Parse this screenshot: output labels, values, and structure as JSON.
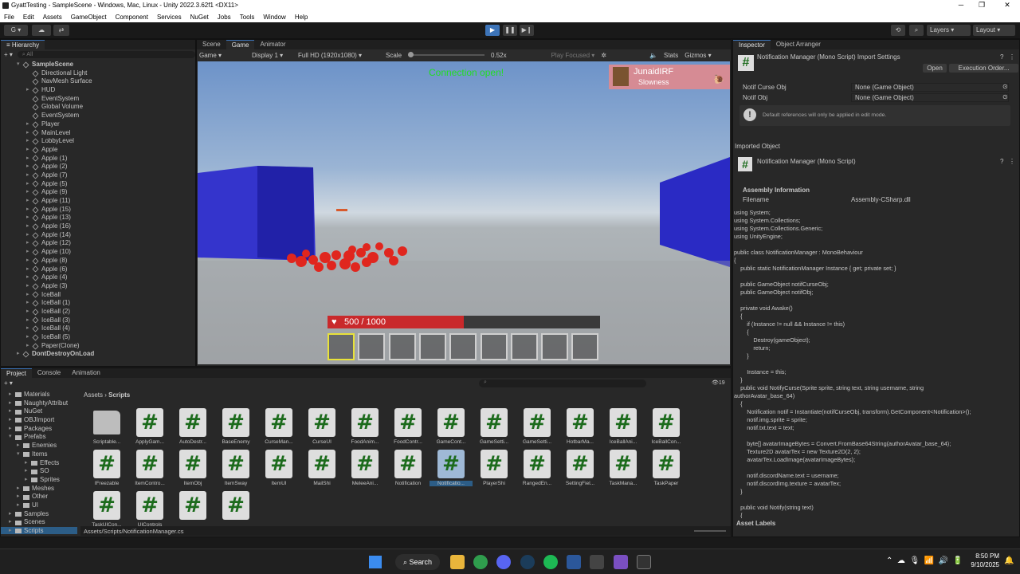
{
  "window": {
    "title": "GyattTesting - SampleScene - Windows, Mac, Linux - Unity 2022.3.62f1 <DX11>",
    "min": "─",
    "max": "❐",
    "close": "✕"
  },
  "menu": [
    "File",
    "Edit",
    "Assets",
    "GameObject",
    "Component",
    "Services",
    "NuGet",
    "Jobs",
    "Tools",
    "Window",
    "Help"
  ],
  "toolbar": {
    "account": "G",
    "layers": "Layers",
    "layout": "Layout"
  },
  "hierarchy": {
    "title": "Hierarchy",
    "search": "All",
    "items": [
      {
        "label": "SampleScene",
        "depth": 0,
        "arrow": "▾",
        "scene": true
      },
      {
        "label": "Directional Light",
        "depth": 1
      },
      {
        "label": "NavMesh Surface",
        "depth": 1
      },
      {
        "label": "HUD",
        "depth": 1,
        "arrow": "▸"
      },
      {
        "label": "EventSystem",
        "depth": 1
      },
      {
        "label": "Global Volume",
        "depth": 1
      },
      {
        "label": "EventSystem",
        "depth": 1
      },
      {
        "label": "Player",
        "depth": 1,
        "arrow": "▸"
      },
      {
        "label": "MainLevel",
        "depth": 1,
        "arrow": "▸"
      },
      {
        "label": "LobbyLevel",
        "depth": 1,
        "arrow": "▸"
      },
      {
        "label": "Apple",
        "depth": 1,
        "arrow": "▸"
      },
      {
        "label": "Apple (1)",
        "depth": 1,
        "arrow": "▸"
      },
      {
        "label": "Apple (2)",
        "depth": 1,
        "arrow": "▸"
      },
      {
        "label": "Apple (7)",
        "depth": 1,
        "arrow": "▸"
      },
      {
        "label": "Apple (5)",
        "depth": 1,
        "arrow": "▸"
      },
      {
        "label": "Apple (9)",
        "depth": 1,
        "arrow": "▸"
      },
      {
        "label": "Apple (11)",
        "depth": 1,
        "arrow": "▸"
      },
      {
        "label": "Apple (15)",
        "depth": 1,
        "arrow": "▸"
      },
      {
        "label": "Apple (13)",
        "depth": 1,
        "arrow": "▸"
      },
      {
        "label": "Apple (16)",
        "depth": 1,
        "arrow": "▸"
      },
      {
        "label": "Apple (14)",
        "depth": 1,
        "arrow": "▸"
      },
      {
        "label": "Apple (12)",
        "depth": 1,
        "arrow": "▸"
      },
      {
        "label": "Apple (10)",
        "depth": 1,
        "arrow": "▸"
      },
      {
        "label": "Apple (8)",
        "depth": 1,
        "arrow": "▸"
      },
      {
        "label": "Apple (6)",
        "depth": 1,
        "arrow": "▸"
      },
      {
        "label": "Apple (4)",
        "depth": 1,
        "arrow": "▸"
      },
      {
        "label": "Apple (3)",
        "depth": 1,
        "arrow": "▸"
      },
      {
        "label": "IceBall",
        "depth": 1,
        "arrow": "▸"
      },
      {
        "label": "IceBall (1)",
        "depth": 1,
        "arrow": "▸"
      },
      {
        "label": "IceBall (2)",
        "depth": 1,
        "arrow": "▸"
      },
      {
        "label": "IceBall (3)",
        "depth": 1,
        "arrow": "▸"
      },
      {
        "label": "IceBall (4)",
        "depth": 1,
        "arrow": "▸"
      },
      {
        "label": "IceBall (5)",
        "depth": 1,
        "arrow": "▸"
      },
      {
        "label": "Paper(Clone)",
        "depth": 1,
        "arrow": "▸"
      },
      {
        "label": "DontDestroyOnLoad",
        "depth": 0,
        "arrow": "▸",
        "scene": true
      }
    ]
  },
  "scene_tabs": [
    "Scene",
    "Game",
    "Animator"
  ],
  "game_bar": {
    "display_mode": "Game",
    "display": "Display 1",
    "resolution": "Full HD (1920x1080)",
    "scale_label": "Scale",
    "scale_value": "0.52x",
    "play_focused": "Play Focused",
    "stats": "Stats",
    "gizmos": "Gizmos"
  },
  "game": {
    "connection": "Connection open!",
    "notif_user": "JunaidIRF",
    "notif_text": "Slowness",
    "hp": "500 / 1000",
    "hp_fraction": 0.5,
    "slot_count": 9,
    "selected_slot": 0
  },
  "inspector": {
    "tabs": [
      "Inspector",
      "Object Arranger"
    ],
    "header": "Notification Manager (Mono Script) Import Settings",
    "open_btn": "Open",
    "exec_btn": "Execution Order...",
    "fields": [
      {
        "label": "Notif Curse Obj",
        "value": "None (Game Object)"
      },
      {
        "label": "Notif Obj",
        "value": "None (Game Object)"
      }
    ],
    "info": "Default references will only be applied in edit mode.",
    "imported_label": "Imported Object",
    "script_name": "Notification Manager (Mono Script)",
    "assembly_title": "Assembly Information",
    "filename_label": "Filename",
    "filename_value": "Assembly-CSharp.dll",
    "code": "using System;\nusing System.Collections;\nusing System.Collections.Generic;\nusing UnityEngine;\n\npublic class NotificationManager : MonoBehaviour\n{\n    public static NotificationManager Instance { get; private set; }\n\n    public GameObject notifCurseObj;\n    public GameObject notifObj;\n\n    private void Awake()\n    {\n        if (Instance != null && Instance != this)\n        {\n            Destroy(gameObject);\n            return;\n        }\n\n        Instance = this;\n    }\n    public void NotifyCurse(Sprite sprite, string text, string username, string\nauthorAvatar_base_64)\n    {\n        Notification notif = Instantiate(notifCurseObj, transform).GetComponent<Notification>();\n        notif.img.sprite = sprite;\n        notif.txt.text = text;\n\n        byte[] avatarImageBytes = Convert.FromBase64String(authorAvatar_base_64);\n        Texture2D avatarTex = new Texture2D(2, 2);\n        avatarTex.LoadImage(avatarImageBytes);\n\n        notif.discordName.text = username;\n        notif.discordImg.texture = avatarTex;\n    }\n\n    public void Notify(string text)\n    {\n        Notification notif = Instantiate(notifObj, transform).GetComponent<Notification>();",
    "asset_labels": "Asset Labels"
  },
  "project": {
    "tabs": [
      "Project",
      "Console",
      "Animation"
    ],
    "breadcrumb_root": "Assets",
    "breadcrumb_current": "Scripts",
    "badge": "19",
    "path": "Assets/Scripts/NotificationManager.cs",
    "tree": [
      {
        "label": "Materials",
        "depth": 1
      },
      {
        "label": "NaughtyAttribut",
        "depth": 1
      },
      {
        "label": "NuGet",
        "depth": 1
      },
      {
        "label": "OBJImport",
        "depth": 1
      },
      {
        "label": "Packages",
        "depth": 1
      },
      {
        "label": "Prefabs",
        "depth": 1,
        "open": true
      },
      {
        "label": "Enemies",
        "depth": 2
      },
      {
        "label": "Items",
        "depth": 2,
        "open": true
      },
      {
        "label": "Effects",
        "depth": 3
      },
      {
        "label": "SO",
        "depth": 3
      },
      {
        "label": "Sprites",
        "depth": 3
      },
      {
        "label": "Meshes",
        "depth": 2
      },
      {
        "label": "Other",
        "depth": 2
      },
      {
        "label": "UI",
        "depth": 2
      },
      {
        "label": "Samples",
        "depth": 1
      },
      {
        "label": "Scenes",
        "depth": 1
      },
      {
        "label": "Scripts",
        "depth": 1,
        "selected": true
      }
    ],
    "assets": [
      {
        "label": "Scriptable...",
        "folder": true
      },
      {
        "label": "ApplyGam..."
      },
      {
        "label": "AutoDestr..."
      },
      {
        "label": "BaseEnemy"
      },
      {
        "label": "CurseMan..."
      },
      {
        "label": "CurseUI"
      },
      {
        "label": "FoodAnim..."
      },
      {
        "label": "FoodContr..."
      },
      {
        "label": "GameCont..."
      },
      {
        "label": "GameSetti..."
      },
      {
        "label": "GameSetti..."
      },
      {
        "label": "HotbarMa..."
      },
      {
        "label": "IceBallAni..."
      },
      {
        "label": "IceBallCon..."
      },
      {
        "label": "IFreezable"
      },
      {
        "label": "ItemContro..."
      },
      {
        "label": "ItemObj"
      },
      {
        "label": "ItemSway"
      },
      {
        "label": "ItemUI"
      },
      {
        "label": "MailShi"
      },
      {
        "label": "MeleeAni..."
      },
      {
        "label": "Notification"
      },
      {
        "label": "Notificatio...",
        "selected": true
      },
      {
        "label": "PlayerShi"
      },
      {
        "label": "RangedEn..."
      },
      {
        "label": "SettingFiel..."
      },
      {
        "label": "TaskMana..."
      },
      {
        "label": "TaskPaper"
      },
      {
        "label": "TaskUICon..."
      },
      {
        "label": "UIControls"
      },
      {
        "label": ""
      },
      {
        "label": ""
      }
    ]
  },
  "taskbar": {
    "search": "Search",
    "time": "8:50 PM",
    "date": "9/10/2025"
  }
}
